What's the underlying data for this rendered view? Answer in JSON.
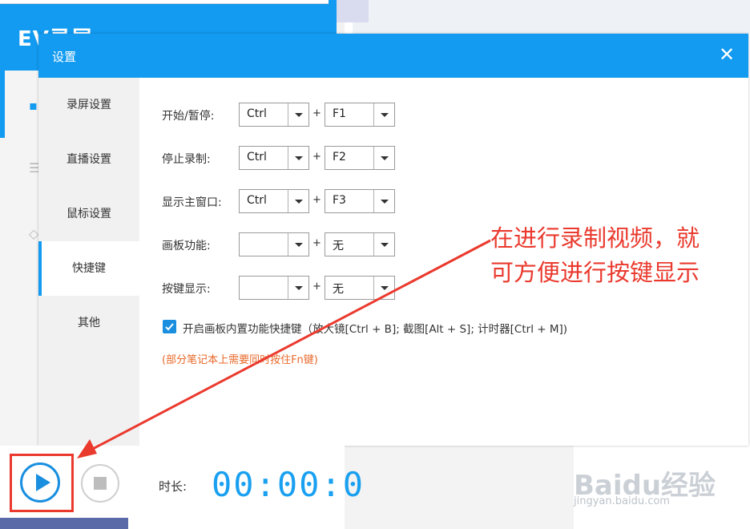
{
  "background_app": {
    "title": "EV录屏"
  },
  "dialog": {
    "title": "设置",
    "close_glyph": "✕",
    "nav": [
      {
        "label": "录屏设置",
        "active": false
      },
      {
        "label": "直播设置",
        "active": false
      },
      {
        "label": "鼠标设置",
        "active": false
      },
      {
        "label": "快捷键",
        "active": true
      },
      {
        "label": "其他",
        "active": false
      }
    ],
    "hotkeys": [
      {
        "label": "开始/暂停:",
        "modifier": "Ctrl",
        "key": "F1"
      },
      {
        "label": "停止录制:",
        "modifier": "Ctrl",
        "key": "F2"
      },
      {
        "label": "显示主窗口:",
        "modifier": "Ctrl",
        "key": "F3"
      },
      {
        "label": "画板功能:",
        "modifier": "",
        "key": "无"
      },
      {
        "label": "按键显示:",
        "modifier": "",
        "key": "无"
      }
    ],
    "plus": "+",
    "checkbox": {
      "checked": true,
      "label": "开启画板内置功能快捷键（放大镜[Ctrl + B]; 截图[Alt + S]; 计时器[Ctrl + M])"
    },
    "note": "(部分笔记本上需要同时按住Fn键)"
  },
  "controls": {
    "duration_label": "时长:",
    "timer": "00:00:0"
  },
  "annotation": {
    "line1": "在进行录制视频，就",
    "line2": "可方便进行按键显示",
    "color": "#ea3a2e"
  },
  "watermark": {
    "text": "Baidu经验",
    "sub": "jingyan.baidu.com"
  },
  "colors": {
    "accent": "#129bf0",
    "annotation_red": "#ea3a2e",
    "note_orange": "#e8692a"
  }
}
